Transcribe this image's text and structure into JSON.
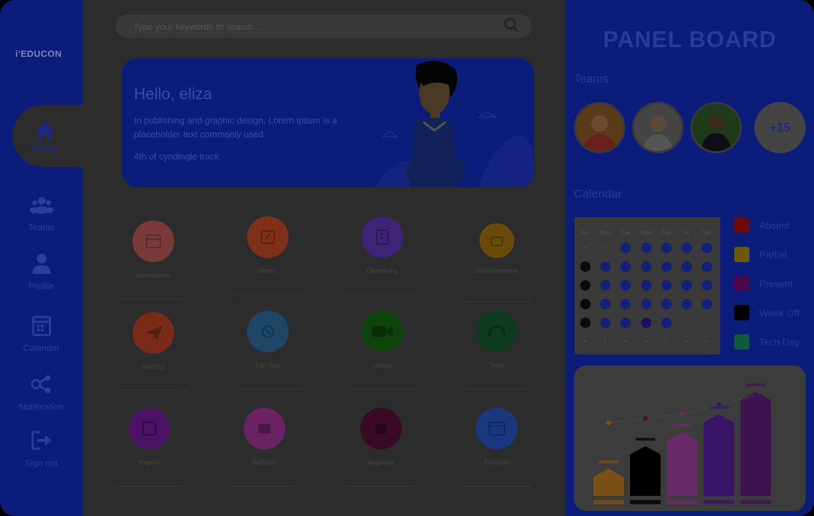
{
  "sidebar": {
    "logo": "i'EDUCON",
    "items": [
      {
        "label": "Home",
        "icon": "home-icon"
      },
      {
        "label": "Teams",
        "icon": "teams-icon"
      },
      {
        "label": "Profile",
        "icon": "profile-icon"
      },
      {
        "label": "Calendar",
        "icon": "calendar-icon"
      },
      {
        "label": "Notification",
        "icon": "notification-icon"
      },
      {
        "label": "Sign out",
        "icon": "sign-out-icon"
      }
    ]
  },
  "search": {
    "placeholder": "Type your keywords to search...",
    "icon": "search-icon"
  },
  "hero": {
    "greeting": "Hello, eliza",
    "line1": "In publishing and graphic design, Lorem ipsum is a placeholder text commonly used",
    "line2": "4th of cyndingle track"
  },
  "apps": [
    {
      "label": "Attendance",
      "color": "#7a3a3a",
      "icon": "attendance-icon"
    },
    {
      "label": "Notes",
      "color": "#803018",
      "icon": "notes-icon"
    },
    {
      "label": "Questions",
      "color": "#3d2476",
      "icon": "questions-icon"
    },
    {
      "label": "Mid-Semester",
      "color": "#6a4a08",
      "icon": "mid-semester-icon"
    },
    {
      "label": "Mailing",
      "color": "#7a2a18",
      "icon": "mailing-icon"
    },
    {
      "label": "Flip Box",
      "color": "#1e4666",
      "icon": "flip-box-icon"
    },
    {
      "label": "Videos",
      "color": "#0d440d",
      "icon": "videos-icon"
    },
    {
      "label": "Tests",
      "color": "#0d3a20",
      "icon": "tests-icon"
    },
    {
      "label": "Report",
      "color": "#4a1262",
      "icon": "report-icon"
    },
    {
      "label": "Website",
      "color": "#6a2262",
      "icon": "website-icon"
    },
    {
      "label": "Approval",
      "color": "#3a0a24",
      "icon": "approval-icon"
    },
    {
      "label": "Projects",
      "color": "#1a3880",
      "icon": "projects-icon"
    }
  ],
  "panel": {
    "title": "PANEL BOARD",
    "teams_label": "Teams",
    "more_members": "+15",
    "calendar_label": "Calendar",
    "weekdays": [
      "Sun",
      "Mon",
      "Tue",
      "Wed",
      "Thu",
      "Fri",
      "Sat"
    ],
    "legend": [
      {
        "label": "Absent",
        "color": "#6a0a0a"
      },
      {
        "label": "Partial",
        "color": "#6a5a08"
      },
      {
        "label": "Present",
        "color": "#4a0a4a"
      },
      {
        "label": "Week Off",
        "color": "#000000"
      },
      {
        "label": "Tech Day",
        "color": "#0e5a3a"
      }
    ]
  },
  "chart_data": {
    "type": "bar",
    "categories": [
      "",
      "",
      "",
      "",
      ""
    ],
    "values": [
      30,
      55,
      70,
      90,
      115
    ],
    "trend": [
      50,
      55,
      60,
      70,
      80
    ],
    "colors": [
      "#7a5016",
      "#000000",
      "#6a2a6a",
      "#3a1466",
      "#3e1450"
    ]
  }
}
